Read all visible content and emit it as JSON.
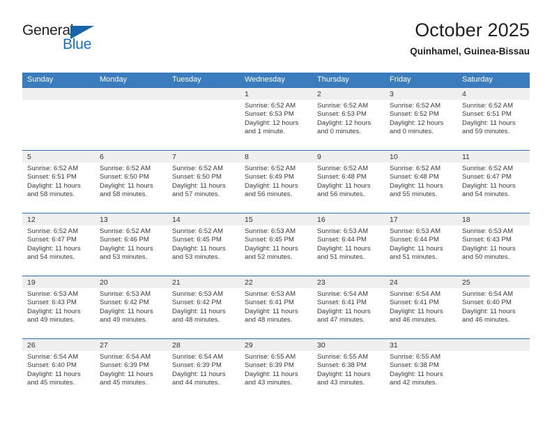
{
  "brand": {
    "name_part1": "General",
    "name_part2": "Blue",
    "accent_color": "#1a6fc4",
    "flag_icon": "triangle-flag-icon"
  },
  "header": {
    "title": "October 2025",
    "location": "Quinhamel, Guinea-Bissau"
  },
  "calendar": {
    "header_bg": "#3a7cbe",
    "row_divider_color": "#2e6da8",
    "daynum_band_bg": "#efefef",
    "weekday_headers": [
      "Sunday",
      "Monday",
      "Tuesday",
      "Wednesday",
      "Thursday",
      "Friday",
      "Saturday"
    ],
    "weeks": [
      [
        {
          "day": ""
        },
        {
          "day": ""
        },
        {
          "day": ""
        },
        {
          "day": "1",
          "sunrise": "Sunrise: 6:52 AM",
          "sunset": "Sunset: 6:53 PM",
          "daylight": "Daylight: 12 hours and 1 minute."
        },
        {
          "day": "2",
          "sunrise": "Sunrise: 6:52 AM",
          "sunset": "Sunset: 6:53 PM",
          "daylight": "Daylight: 12 hours and 0 minutes."
        },
        {
          "day": "3",
          "sunrise": "Sunrise: 6:52 AM",
          "sunset": "Sunset: 6:52 PM",
          "daylight": "Daylight: 12 hours and 0 minutes."
        },
        {
          "day": "4",
          "sunrise": "Sunrise: 6:52 AM",
          "sunset": "Sunset: 6:51 PM",
          "daylight": "Daylight: 11 hours and 59 minutes."
        }
      ],
      [
        {
          "day": "5",
          "sunrise": "Sunrise: 6:52 AM",
          "sunset": "Sunset: 6:51 PM",
          "daylight": "Daylight: 11 hours and 58 minutes."
        },
        {
          "day": "6",
          "sunrise": "Sunrise: 6:52 AM",
          "sunset": "Sunset: 6:50 PM",
          "daylight": "Daylight: 11 hours and 58 minutes."
        },
        {
          "day": "7",
          "sunrise": "Sunrise: 6:52 AM",
          "sunset": "Sunset: 6:50 PM",
          "daylight": "Daylight: 11 hours and 57 minutes."
        },
        {
          "day": "8",
          "sunrise": "Sunrise: 6:52 AM",
          "sunset": "Sunset: 6:49 PM",
          "daylight": "Daylight: 11 hours and 56 minutes."
        },
        {
          "day": "9",
          "sunrise": "Sunrise: 6:52 AM",
          "sunset": "Sunset: 6:48 PM",
          "daylight": "Daylight: 11 hours and 56 minutes."
        },
        {
          "day": "10",
          "sunrise": "Sunrise: 6:52 AM",
          "sunset": "Sunset: 6:48 PM",
          "daylight": "Daylight: 11 hours and 55 minutes."
        },
        {
          "day": "11",
          "sunrise": "Sunrise: 6:52 AM",
          "sunset": "Sunset: 6:47 PM",
          "daylight": "Daylight: 11 hours and 54 minutes."
        }
      ],
      [
        {
          "day": "12",
          "sunrise": "Sunrise: 6:52 AM",
          "sunset": "Sunset: 6:47 PM",
          "daylight": "Daylight: 11 hours and 54 minutes."
        },
        {
          "day": "13",
          "sunrise": "Sunrise: 6:52 AM",
          "sunset": "Sunset: 6:46 PM",
          "daylight": "Daylight: 11 hours and 53 minutes."
        },
        {
          "day": "14",
          "sunrise": "Sunrise: 6:52 AM",
          "sunset": "Sunset: 6:45 PM",
          "daylight": "Daylight: 11 hours and 53 minutes."
        },
        {
          "day": "15",
          "sunrise": "Sunrise: 6:53 AM",
          "sunset": "Sunset: 6:45 PM",
          "daylight": "Daylight: 11 hours and 52 minutes."
        },
        {
          "day": "16",
          "sunrise": "Sunrise: 6:53 AM",
          "sunset": "Sunset: 6:44 PM",
          "daylight": "Daylight: 11 hours and 51 minutes."
        },
        {
          "day": "17",
          "sunrise": "Sunrise: 6:53 AM",
          "sunset": "Sunset: 6:44 PM",
          "daylight": "Daylight: 11 hours and 51 minutes."
        },
        {
          "day": "18",
          "sunrise": "Sunrise: 6:53 AM",
          "sunset": "Sunset: 6:43 PM",
          "daylight": "Daylight: 11 hours and 50 minutes."
        }
      ],
      [
        {
          "day": "19",
          "sunrise": "Sunrise: 6:53 AM",
          "sunset": "Sunset: 6:43 PM",
          "daylight": "Daylight: 11 hours and 49 minutes."
        },
        {
          "day": "20",
          "sunrise": "Sunrise: 6:53 AM",
          "sunset": "Sunset: 6:42 PM",
          "daylight": "Daylight: 11 hours and 49 minutes."
        },
        {
          "day": "21",
          "sunrise": "Sunrise: 6:53 AM",
          "sunset": "Sunset: 6:42 PM",
          "daylight": "Daylight: 11 hours and 48 minutes."
        },
        {
          "day": "22",
          "sunrise": "Sunrise: 6:53 AM",
          "sunset": "Sunset: 6:41 PM",
          "daylight": "Daylight: 11 hours and 48 minutes."
        },
        {
          "day": "23",
          "sunrise": "Sunrise: 6:54 AM",
          "sunset": "Sunset: 6:41 PM",
          "daylight": "Daylight: 11 hours and 47 minutes."
        },
        {
          "day": "24",
          "sunrise": "Sunrise: 6:54 AM",
          "sunset": "Sunset: 6:41 PM",
          "daylight": "Daylight: 11 hours and 46 minutes."
        },
        {
          "day": "25",
          "sunrise": "Sunrise: 6:54 AM",
          "sunset": "Sunset: 6:40 PM",
          "daylight": "Daylight: 11 hours and 46 minutes."
        }
      ],
      [
        {
          "day": "26",
          "sunrise": "Sunrise: 6:54 AM",
          "sunset": "Sunset: 6:40 PM",
          "daylight": "Daylight: 11 hours and 45 minutes."
        },
        {
          "day": "27",
          "sunrise": "Sunrise: 6:54 AM",
          "sunset": "Sunset: 6:39 PM",
          "daylight": "Daylight: 11 hours and 45 minutes."
        },
        {
          "day": "28",
          "sunrise": "Sunrise: 6:54 AM",
          "sunset": "Sunset: 6:39 PM",
          "daylight": "Daylight: 11 hours and 44 minutes."
        },
        {
          "day": "29",
          "sunrise": "Sunrise: 6:55 AM",
          "sunset": "Sunset: 6:39 PM",
          "daylight": "Daylight: 11 hours and 43 minutes."
        },
        {
          "day": "30",
          "sunrise": "Sunrise: 6:55 AM",
          "sunset": "Sunset: 6:38 PM",
          "daylight": "Daylight: 11 hours and 43 minutes."
        },
        {
          "day": "31",
          "sunrise": "Sunrise: 6:55 AM",
          "sunset": "Sunset: 6:38 PM",
          "daylight": "Daylight: 11 hours and 42 minutes."
        },
        {
          "day": ""
        }
      ]
    ]
  }
}
